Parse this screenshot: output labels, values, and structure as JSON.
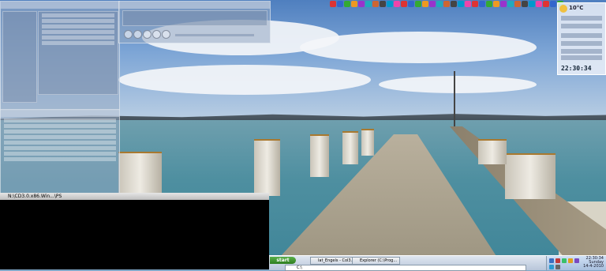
{
  "desktop": {
    "wallpaper": "wooden pier over sea",
    "colors": {
      "sky": "#7ea6d6",
      "sea": "#4e8fa0",
      "taskbar": "#b8c6da",
      "start_green": "#2e7d1f"
    }
  },
  "console": {
    "title": "N:\\CD3.0.x86.Win...\\PS"
  },
  "weather_widget": {
    "temperature": "10°C",
    "time": "22:30:34",
    "date": "Wednesday, 14-4-2010"
  },
  "taskbar": {
    "start_label": "start",
    "buttons": [
      {
        "label": "lat_Engels - Col3...",
        "icon": "browser-icon"
      },
      {
        "label": "Explorer (C:\\Prog...",
        "icon": "folder-icon"
      }
    ],
    "address_label": "Address",
    "address_value": "C:\\",
    "clock_time": "22:30:34",
    "clock_day": "Sunday",
    "clock_date": "14-4-2010"
  },
  "top_icons": [
    "app-icon-1",
    "app-icon-2",
    "app-icon-3",
    "app-icon-4",
    "app-icon-5",
    "app-icon-6",
    "app-icon-7",
    "app-icon-8",
    "app-icon-9",
    "app-icon-10",
    "app-icon-11",
    "app-icon-12",
    "app-icon-13",
    "app-icon-14",
    "app-icon-15",
    "app-icon-16",
    "app-icon-17",
    "app-icon-18",
    "app-icon-19",
    "app-icon-20",
    "app-icon-21",
    "app-icon-22",
    "app-icon-23",
    "app-icon-24",
    "app-icon-25",
    "app-icon-26",
    "app-icon-27",
    "app-icon-28",
    "app-icon-29",
    "app-icon-30",
    "app-icon-31",
    "app-icon-32",
    "app-icon-33"
  ]
}
